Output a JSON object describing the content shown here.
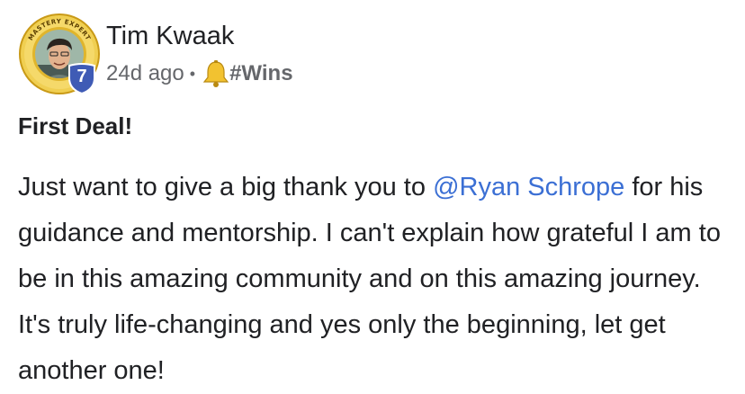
{
  "post": {
    "author": {
      "name": "Tim Kwaak",
      "badge_text": "MASTERY EXPERT",
      "level": "7"
    },
    "meta": {
      "time": "24d ago",
      "separator": "•",
      "category_icon": "bell-icon",
      "category": "#Wins"
    },
    "title": "First Deal!",
    "body": {
      "prefix": "Just want to give a big thank you to ",
      "mention": "@Ryan Schrope",
      "suffix": " for his guidance and mentorship. I can't explain how grateful I am to be in this amazing community and on this amazing journey. It's truly life-changing and yes only the beginning, let get another one!"
    }
  },
  "colors": {
    "mention": "#3b6fd4",
    "badge_ring": "#e9c23a",
    "level_badge": "#3f5bb5",
    "text": "#202124",
    "meta_text": "#65676b"
  }
}
